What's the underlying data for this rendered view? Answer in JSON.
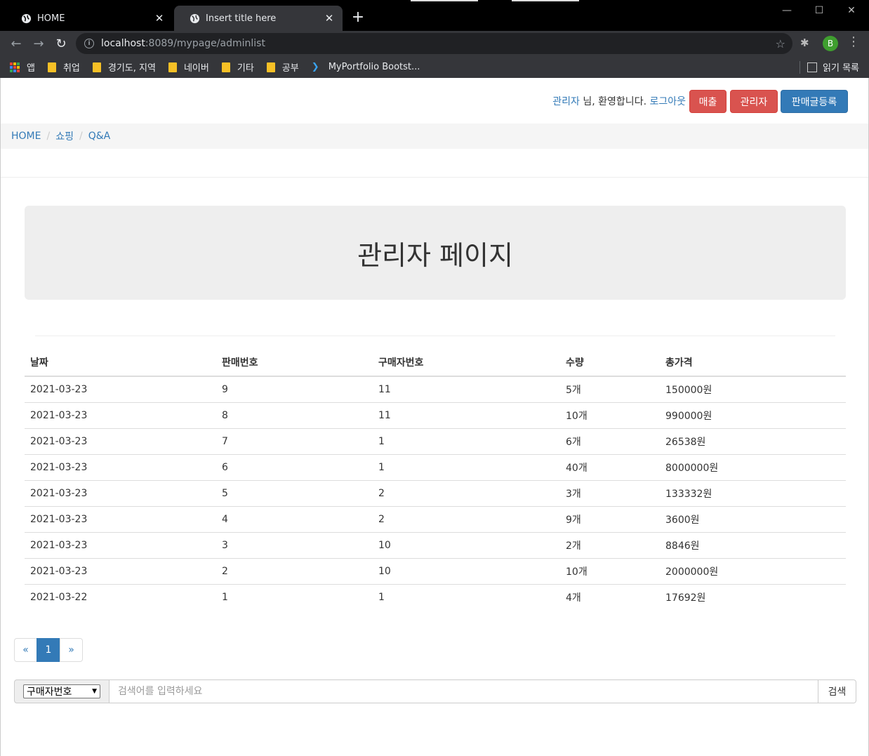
{
  "browser": {
    "tabs": [
      {
        "title": "HOME",
        "active": false
      },
      {
        "title": "Insert title here",
        "active": true
      }
    ],
    "url_host": "localhost",
    "url_path": ":8089/mypage/adminlist",
    "profile_initial": "B",
    "bookmarks": [
      "앱",
      "취업",
      "경기도, 지역",
      "네이버",
      "기타",
      "공부",
      "MyPortfolio Bootst..."
    ],
    "reading_list": "읽기 목록"
  },
  "header": {
    "user_name": "관리자",
    "greeting": " 님, 환영합니다. ",
    "logout": "로그아웃",
    "buttons": {
      "sales": "매출",
      "admin": "관리자",
      "register": "판매글등록"
    },
    "colors": {
      "danger": "#d9534f",
      "primary": "#337ab7"
    }
  },
  "breadcrumb": [
    "HOME",
    "쇼핑",
    "Q&A"
  ],
  "jumbotron": {
    "title": "관리자 페이지"
  },
  "table": {
    "headers": [
      "날짜",
      "판매번호",
      "구매자번호",
      "수량",
      "총가격"
    ],
    "rows": [
      [
        "2021-03-23",
        "9",
        "11",
        "5개",
        "150000원"
      ],
      [
        "2021-03-23",
        "8",
        "11",
        "10개",
        "990000원"
      ],
      [
        "2021-03-23",
        "7",
        "1",
        "6개",
        "26538원"
      ],
      [
        "2021-03-23",
        "6",
        "1",
        "40개",
        "8000000원"
      ],
      [
        "2021-03-23",
        "5",
        "2",
        "3개",
        "133332원"
      ],
      [
        "2021-03-23",
        "4",
        "2",
        "9개",
        "3600원"
      ],
      [
        "2021-03-23",
        "3",
        "10",
        "2개",
        "8846원"
      ],
      [
        "2021-03-23",
        "2",
        "10",
        "10개",
        "2000000원"
      ],
      [
        "2021-03-22",
        "1",
        "1",
        "4개",
        "17692원"
      ]
    ]
  },
  "pagination": {
    "prev": "«",
    "current": "1",
    "next": "»"
  },
  "search": {
    "field": "구매자번호",
    "placeholder": "검색어를 입력하세요",
    "button": "검색"
  }
}
